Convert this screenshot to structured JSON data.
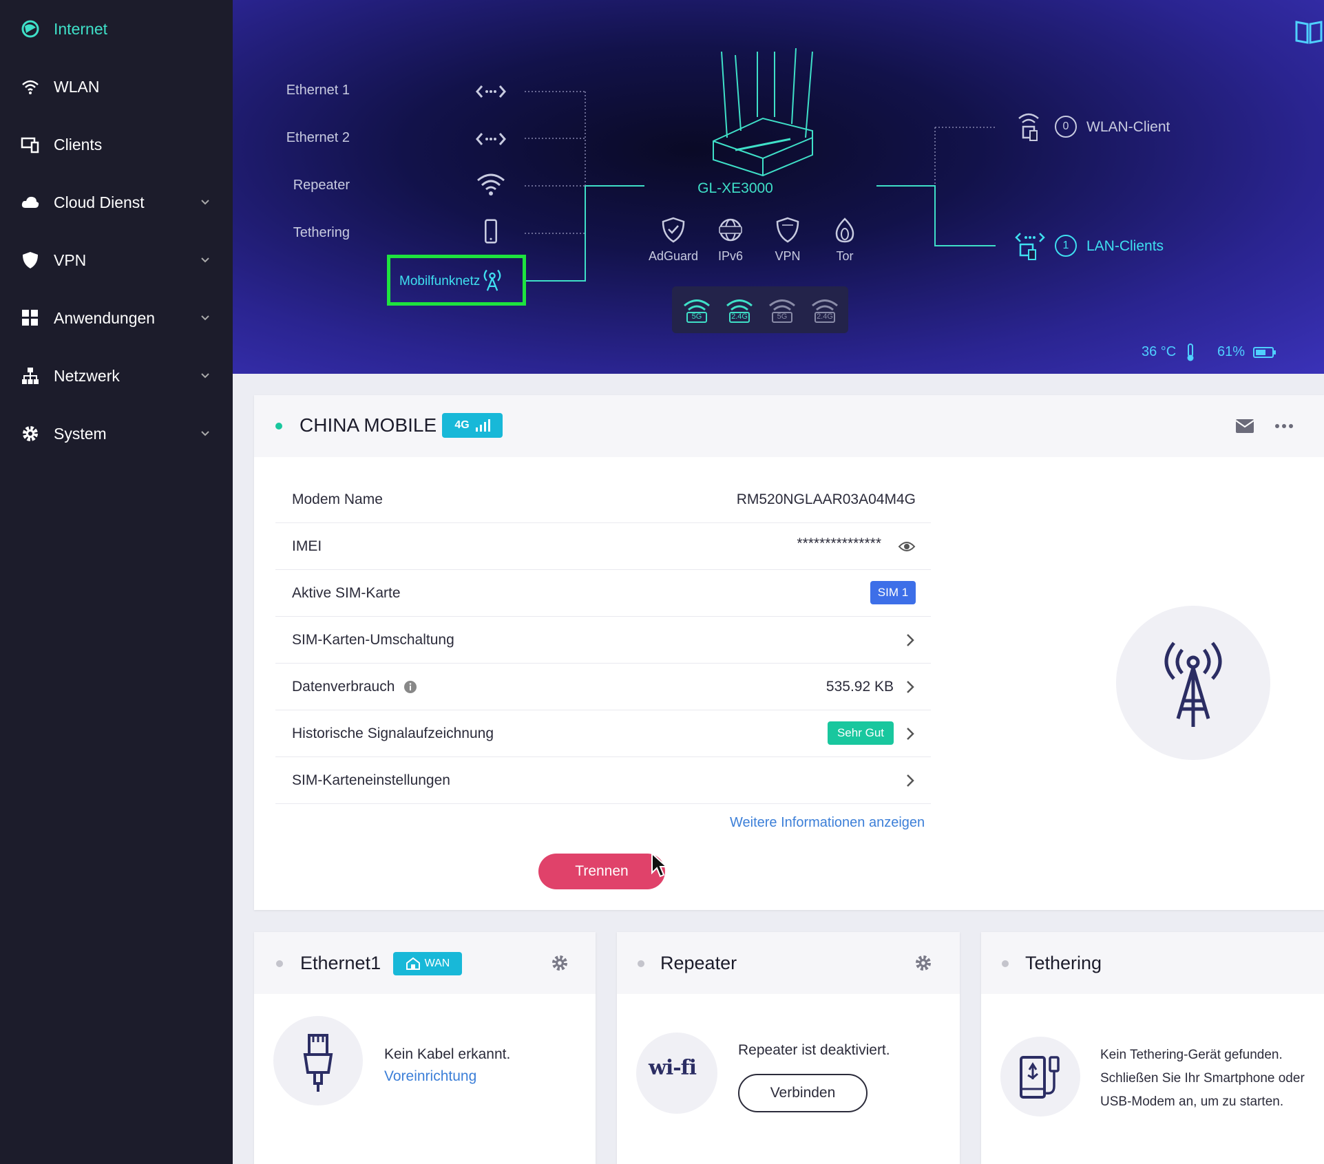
{
  "sidebar": {
    "items": [
      {
        "label": "Internet",
        "icon": "globe-icon"
      },
      {
        "label": "WLAN",
        "icon": "wifi-icon"
      },
      {
        "label": "Clients",
        "icon": "devices-icon"
      },
      {
        "label": "Cloud Dienst",
        "icon": "cloud-icon"
      },
      {
        "label": "VPN",
        "icon": "shield-icon"
      },
      {
        "label": "Anwendungen",
        "icon": "apps-icon"
      },
      {
        "label": "Netzwerk",
        "icon": "network-icon"
      },
      {
        "label": "System",
        "icon": "gear-icon"
      }
    ]
  },
  "topology": {
    "sources": [
      {
        "label": "Ethernet 1",
        "icon": "ethernet-arrows-icon"
      },
      {
        "label": "Ethernet 2",
        "icon": "ethernet-arrows-icon"
      },
      {
        "label": "Repeater",
        "icon": "wifi-icon"
      },
      {
        "label": "Tethering",
        "icon": "phone-icon"
      },
      {
        "label": "Mobilfunknetz",
        "icon": "antenna-icon"
      }
    ],
    "router_name": "GL-XE3000",
    "features": [
      {
        "label": "AdGuard",
        "icon": "adguard-icon"
      },
      {
        "label": "IPv6",
        "icon": "ipv6-icon"
      },
      {
        "label": "VPN",
        "icon": "vpn-icon"
      },
      {
        "label": "Tor",
        "icon": "tor-icon"
      }
    ],
    "bands": [
      "5G",
      "2.4G",
      "5G",
      "2.4G"
    ],
    "wlan_clients": {
      "count": "0",
      "label": "WLAN-Client"
    },
    "lan_clients": {
      "count": "1",
      "label": "LAN-Clients"
    },
    "temperature": "36 °C",
    "battery": "61%"
  },
  "colors": {
    "accent": "#3fe0c8",
    "highlight": "#1ee33e",
    "danger": "#e0426a",
    "badge": "#18b8d8",
    "sim": "#3d6fe8",
    "good": "#19c79e"
  },
  "mobile": {
    "carrier": "CHINA MOBILE",
    "network_badge": "4G",
    "rows": [
      {
        "label": "Modem Name",
        "value": "RM520NGLAAR03A04M4G"
      },
      {
        "label": "IMEI",
        "value": "***************"
      },
      {
        "label": "Aktive SIM-Karte",
        "value": "SIM 1"
      },
      {
        "label": "SIM-Karten-Umschaltung",
        "value": ""
      },
      {
        "label": "Datenverbrauch",
        "value": "535.92 KB"
      },
      {
        "label": "Historische Signalaufzeichnung",
        "value": "Sehr Gut"
      },
      {
        "label": "SIM-Karteneinstellungen",
        "value": ""
      }
    ],
    "more_link": "Weitere Informationen anzeigen",
    "disconnect_label": "Trennen"
  },
  "ethernet_card": {
    "title": "Ethernet1",
    "badge": "WAN",
    "message": "Kein Kabel erkannt.",
    "link": "Voreinrichtung"
  },
  "repeater_card": {
    "title": "Repeater",
    "message": "Repeater ist deaktiviert.",
    "button": "Verbinden",
    "wifi_text": "wi-fi"
  },
  "tethering_card": {
    "title": "Tethering",
    "message_lines": [
      "Kein Tethering-Gerät gefunden.",
      "Schließen Sie Ihr Smartphone oder",
      "USB-Modem an, um zu starten."
    ]
  }
}
